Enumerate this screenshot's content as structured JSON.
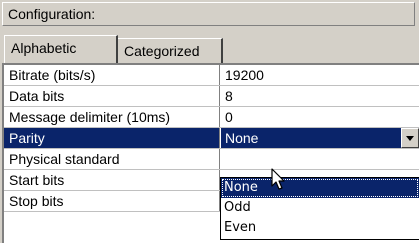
{
  "header": {
    "title": "Configuration:"
  },
  "tabs": [
    {
      "label": "Alphabetic",
      "active": true
    },
    {
      "label": "Categorized",
      "active": false
    }
  ],
  "properties": [
    {
      "label": "Bitrate (bits/s)",
      "value": "19200"
    },
    {
      "label": "Data bits",
      "value": "8"
    },
    {
      "label": "Message delimiter (10ms)",
      "value": "0"
    },
    {
      "label": "Parity",
      "value": "None"
    },
    {
      "label": "Physical standard",
      "value": ""
    },
    {
      "label": "Start bits",
      "value": ""
    },
    {
      "label": "Stop bits",
      "value": ""
    }
  ],
  "dropdown": {
    "options": [
      "None",
      "Odd",
      "Even"
    ],
    "highlighted": "None"
  },
  "colors": {
    "selection": "#0a246a",
    "panel": "#d4d0c8"
  },
  "icons": {
    "dropdown_button": "chevron-down-icon",
    "cursor": "mouse-pointer-icon"
  }
}
